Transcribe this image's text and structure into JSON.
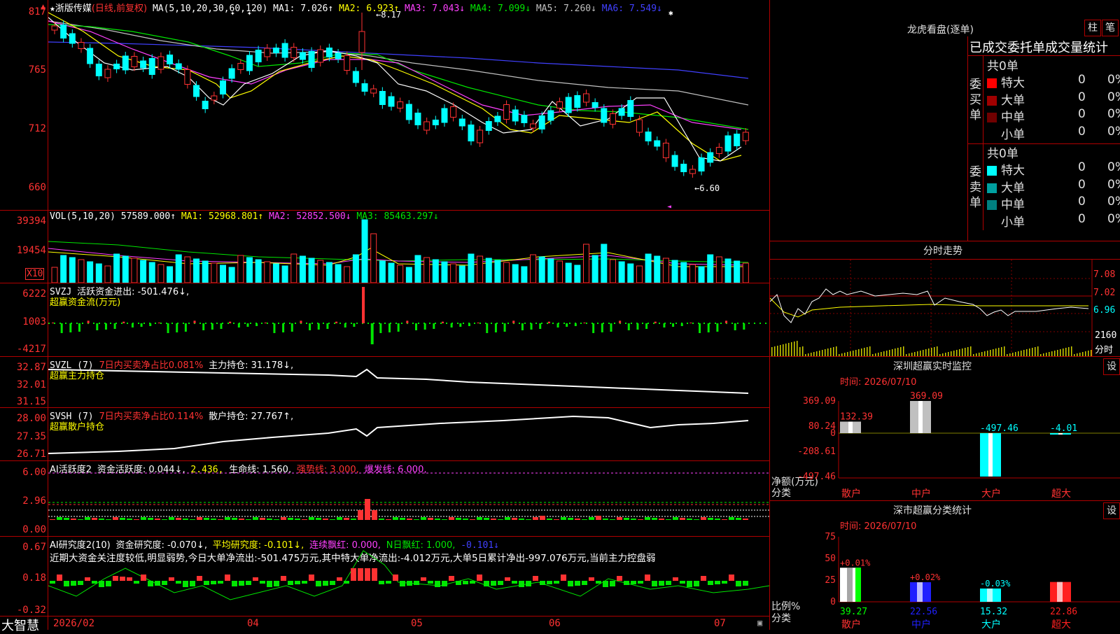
{
  "main": {
    "title_star": "★",
    "stock_name": "浙版传媒",
    "period": "(日线,前复权)",
    "ma_def": "MA(5,10,20,30,60,120)",
    "ma1": "MA1: 7.026↑",
    "ma2": "MA2: 6.923↑",
    "ma3": "MA3: 7.043↓",
    "ma4": "MA4: 7.099↓",
    "ma5": "MA5: 7.260↓",
    "ma6": "MA6: 7.549↓",
    "yticks": [
      "817",
      "765",
      "712",
      "660"
    ],
    "high_mark": "8.17",
    "low_mark": "6.60",
    "colors": {
      "up": "#ff3232",
      "down": "#00ffff",
      "ma1": "#ffffff",
      "ma2": "#ffff00",
      "ma3": "#ff40ff",
      "ma4": "#00e600",
      "ma5": "#c0c0c0",
      "ma6": "#4040ff"
    }
  },
  "vol": {
    "title": "VOL(5,10,20)",
    "value": "57589.000↑",
    "ma1": "MA1: 52968.801↑",
    "ma2": "MA2: 52852.500↓",
    "ma3": "MA3: 85463.297↓",
    "yticks": [
      "39394",
      "19454"
    ],
    "unit": "X10"
  },
  "svzj": {
    "title": "SVZJ",
    "line": "活跃资金进出: -501.476↓,",
    "sub": "超赢资金流(万元)",
    "yticks": [
      "6222",
      "1003",
      "-4217"
    ]
  },
  "svzl": {
    "title": "SVZL (7)",
    "ratio": "7日内买卖净占比0.081%",
    "hold": "主力持仓: 31.178↓,",
    "sub": "超赢主力持仓",
    "yticks": [
      "32.87",
      "32.01",
      "31.15"
    ]
  },
  "svsh": {
    "title": "SVSH (7)",
    "ratio": "7日内买卖净占比0.114%",
    "hold": "散户持仓: 27.767↑,",
    "sub": "超赢散户持仓",
    "yticks": [
      "28.00",
      "27.35",
      "26.71"
    ]
  },
  "ai_active": {
    "title": "AI活跃度2",
    "l1": "资金活跃度: 0.044↓,",
    "l2": "2.436,",
    "l3": "生命线: 1.560,",
    "l4": "强势线: 3.000,",
    "l5": "爆发线: 6.000,",
    "yticks": [
      "6.00",
      "2.96",
      "0.00"
    ]
  },
  "ai_research": {
    "title": "AI研究度2(10)",
    "l1": "资金研究度: -0.070↓,",
    "l2": "平均研究度: -0.101↓,",
    "l3": "连续飘红: 0.000,",
    "l4": "N日飘红: 1.000,",
    "l5": "-0.101↓",
    "comment": "近期大资金关注度较低,明显弱势,今日大单净流出:-501.475万元,其中特大单净流出:-4.012万元,大单5日累计净出-997.076万元,当前主力控盘弱",
    "yticks": [
      "0.67",
      "0.18",
      "-0.32"
    ]
  },
  "xaxis": {
    "brand": "大智慧",
    "labels": [
      "2026/02",
      "04",
      "05",
      "06",
      "07"
    ]
  },
  "dragon": {
    "title": "龙虎看盘(逐单)",
    "btn1": "柱",
    "btn2": "笔",
    "subtitle": "已成交委托单成交量统计",
    "buy_label": "委买单",
    "sell_label": "委卖单",
    "buy_total": "共0单",
    "sell_total": "共0单",
    "buy_rows": [
      {
        "name": "特大",
        "count": "0",
        "pct": "0%",
        "color": "#ff0000"
      },
      {
        "name": "大单",
        "count": "0",
        "pct": "0%",
        "color": "#a00000"
      },
      {
        "name": "中单",
        "count": "0",
        "pct": "0%",
        "color": "#700000"
      },
      {
        "name": "小单",
        "count": "0",
        "pct": "0%",
        "color": "#000000"
      }
    ],
    "sell_rows": [
      {
        "name": "特大",
        "count": "0",
        "pct": "0%",
        "color": "#00ffff"
      },
      {
        "name": "大单",
        "count": "0",
        "pct": "0%",
        "color": "#00a0a0"
      },
      {
        "name": "中单",
        "count": "0",
        "pct": "0%",
        "color": "#008080"
      },
      {
        "name": "小单",
        "count": "0",
        "pct": "0%",
        "color": "#000000"
      }
    ]
  },
  "intraday": {
    "title": "分时走势",
    "yticks": [
      "7.08",
      "7.02",
      "6.96"
    ],
    "vol_tick": "2160",
    "vol_label": "分时"
  },
  "sz_monitor": {
    "title": "深圳超赢实时监控",
    "btn": "设",
    "time": "时间: 2026/07/10",
    "yticks": [
      "369.09",
      "80.24",
      "0",
      "-208.61",
      "-497.46"
    ],
    "ylabel": "净额(万元)",
    "xlabel": "分类",
    "categories": [
      "散户",
      "中户",
      "大户",
      "超大"
    ],
    "values": [
      132.39,
      369.09,
      -497.46,
      -4.01
    ],
    "value_labels": [
      "132.39",
      "369.09",
      "-497.46",
      "-4.01"
    ]
  },
  "sz_class": {
    "title": "深市超赢分类统计",
    "btn": "设",
    "time": "时间: 2026/07/10",
    "yticks": [
      "75",
      "50",
      "25",
      "0"
    ],
    "ylabel": "比例%",
    "xlabel": "分类",
    "categories": [
      "散户",
      "中户",
      "大户",
      "超大"
    ],
    "values": [
      39.27,
      22.56,
      15.32,
      22.86
    ],
    "deltas": [
      "+0.01%",
      "+0.02%",
      "-0.03%",
      ""
    ],
    "colors": [
      "#ffffff",
      "#2020ff",
      "#00ffff",
      "#ff2020"
    ]
  }
}
